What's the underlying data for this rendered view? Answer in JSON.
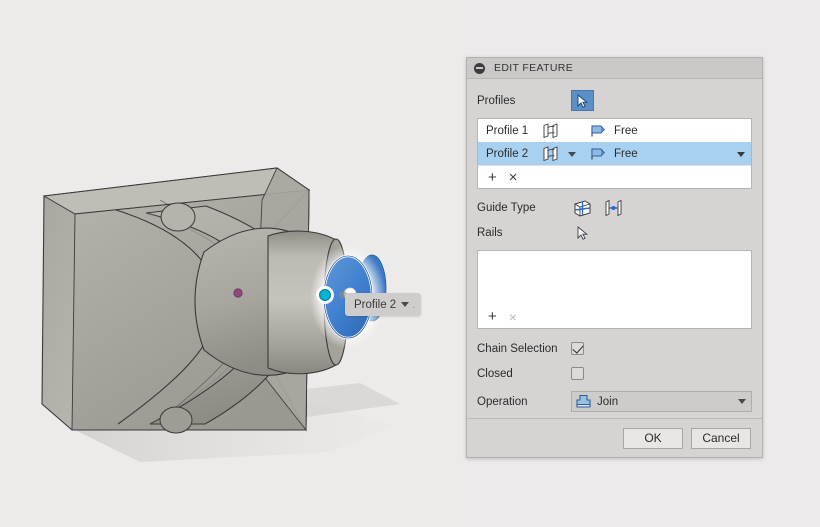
{
  "canvas": {
    "background_color": "#ecebea",
    "selection_badge": {
      "label": "Profile 2",
      "caret": "chevron-down-icon",
      "tail": "."
    },
    "model": {
      "body_color": "#b3b0aa",
      "highlight_color": "#3f7fd0",
      "sketch_point_color": "#8e4a7e",
      "vertex_point_color": "#00b5d4"
    }
  },
  "toolbar": {
    "icon": "minus-circle-icon"
  },
  "dialog": {
    "collapse_icon": "collapse-icon",
    "title": "EDIT FEATURE",
    "profiles": {
      "label": "Profiles",
      "select_icon": "cursor-arrow-icon",
      "columns": [
        "name",
        "profile-icon",
        "chain-caret",
        "flag-icon",
        "condition",
        "condition-caret"
      ],
      "rows": [
        {
          "name": "Profile 1",
          "icon": "loft-profile-icon",
          "flag": "free-flag-icon",
          "condition": "Free",
          "selected": false,
          "has_caret": false
        },
        {
          "name": "Profile 2",
          "icon": "loft-profile-icon",
          "flag": "free-flag-icon",
          "condition": "Free",
          "selected": true,
          "has_caret": true
        }
      ],
      "add_label": "+",
      "remove_label": "×"
    },
    "guide_type": {
      "label": "Guide Type",
      "options": [
        {
          "name": "rails-guide-icon",
          "active": true
        },
        {
          "name": "centerline-guide-icon",
          "active": false
        }
      ]
    },
    "rails": {
      "label": "Rails",
      "select_icon": "cursor-arrow-icon",
      "items": [],
      "add_label": "+",
      "remove_label": "×"
    },
    "chain_selection": {
      "label": "Chain Selection",
      "checked": true
    },
    "closed": {
      "label": "Closed",
      "checked": false
    },
    "operation": {
      "label": "Operation",
      "icon": "join-operation-icon",
      "value": "Join",
      "caret": "chevron-down-icon"
    },
    "footer": {
      "ok_label": "OK",
      "cancel_label": "Cancel"
    }
  }
}
